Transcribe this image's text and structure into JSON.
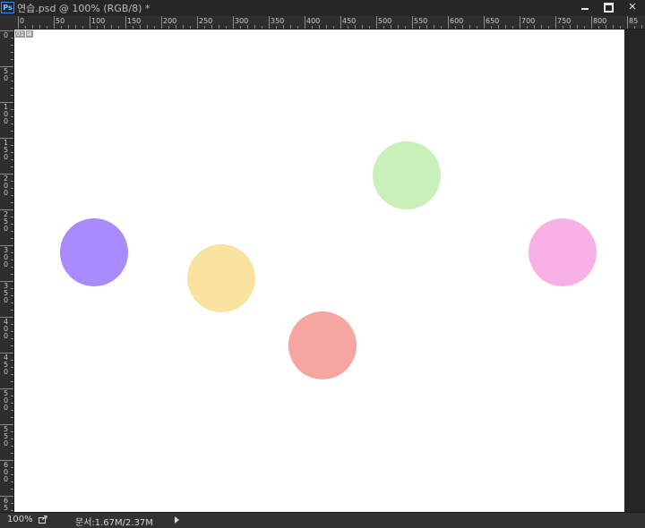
{
  "window": {
    "app_badge": "Ps",
    "document_title": "연습.psd @ 100% (RGB/8) *",
    "buttons": {
      "minimize": "minimize-icon",
      "maximize": "maximize-icon",
      "close": "close-icon",
      "close_glyph": "✕"
    }
  },
  "rulers": {
    "horizontal_labels": [
      "0",
      "50",
      "100",
      "150",
      "200",
      "250",
      "300",
      "350",
      "400",
      "450",
      "500",
      "550",
      "600",
      "650",
      "700",
      "750",
      "800",
      "85"
    ],
    "vertical_labels": [
      "0",
      "50",
      "100",
      "150",
      "200",
      "250",
      "300",
      "350",
      "400",
      "450",
      "500",
      "550",
      "600",
      "65"
    ]
  },
  "canvas": {
    "background": "#ffffff",
    "slice_badge": [
      "01",
      "⊠"
    ],
    "circles": [
      {
        "name": "purple-circle",
        "color": "#a98bff"
      },
      {
        "name": "yellow-circle",
        "color": "#fae3a1"
      },
      {
        "name": "green-circle",
        "color": "#c8f0b8"
      },
      {
        "name": "red-circle",
        "color": "#f6a5a1"
      },
      {
        "name": "pink-circle",
        "color": "#f8b1e7"
      }
    ]
  },
  "status": {
    "zoom": "100%",
    "doc_info": "문서:1.67M/2.37M"
  }
}
